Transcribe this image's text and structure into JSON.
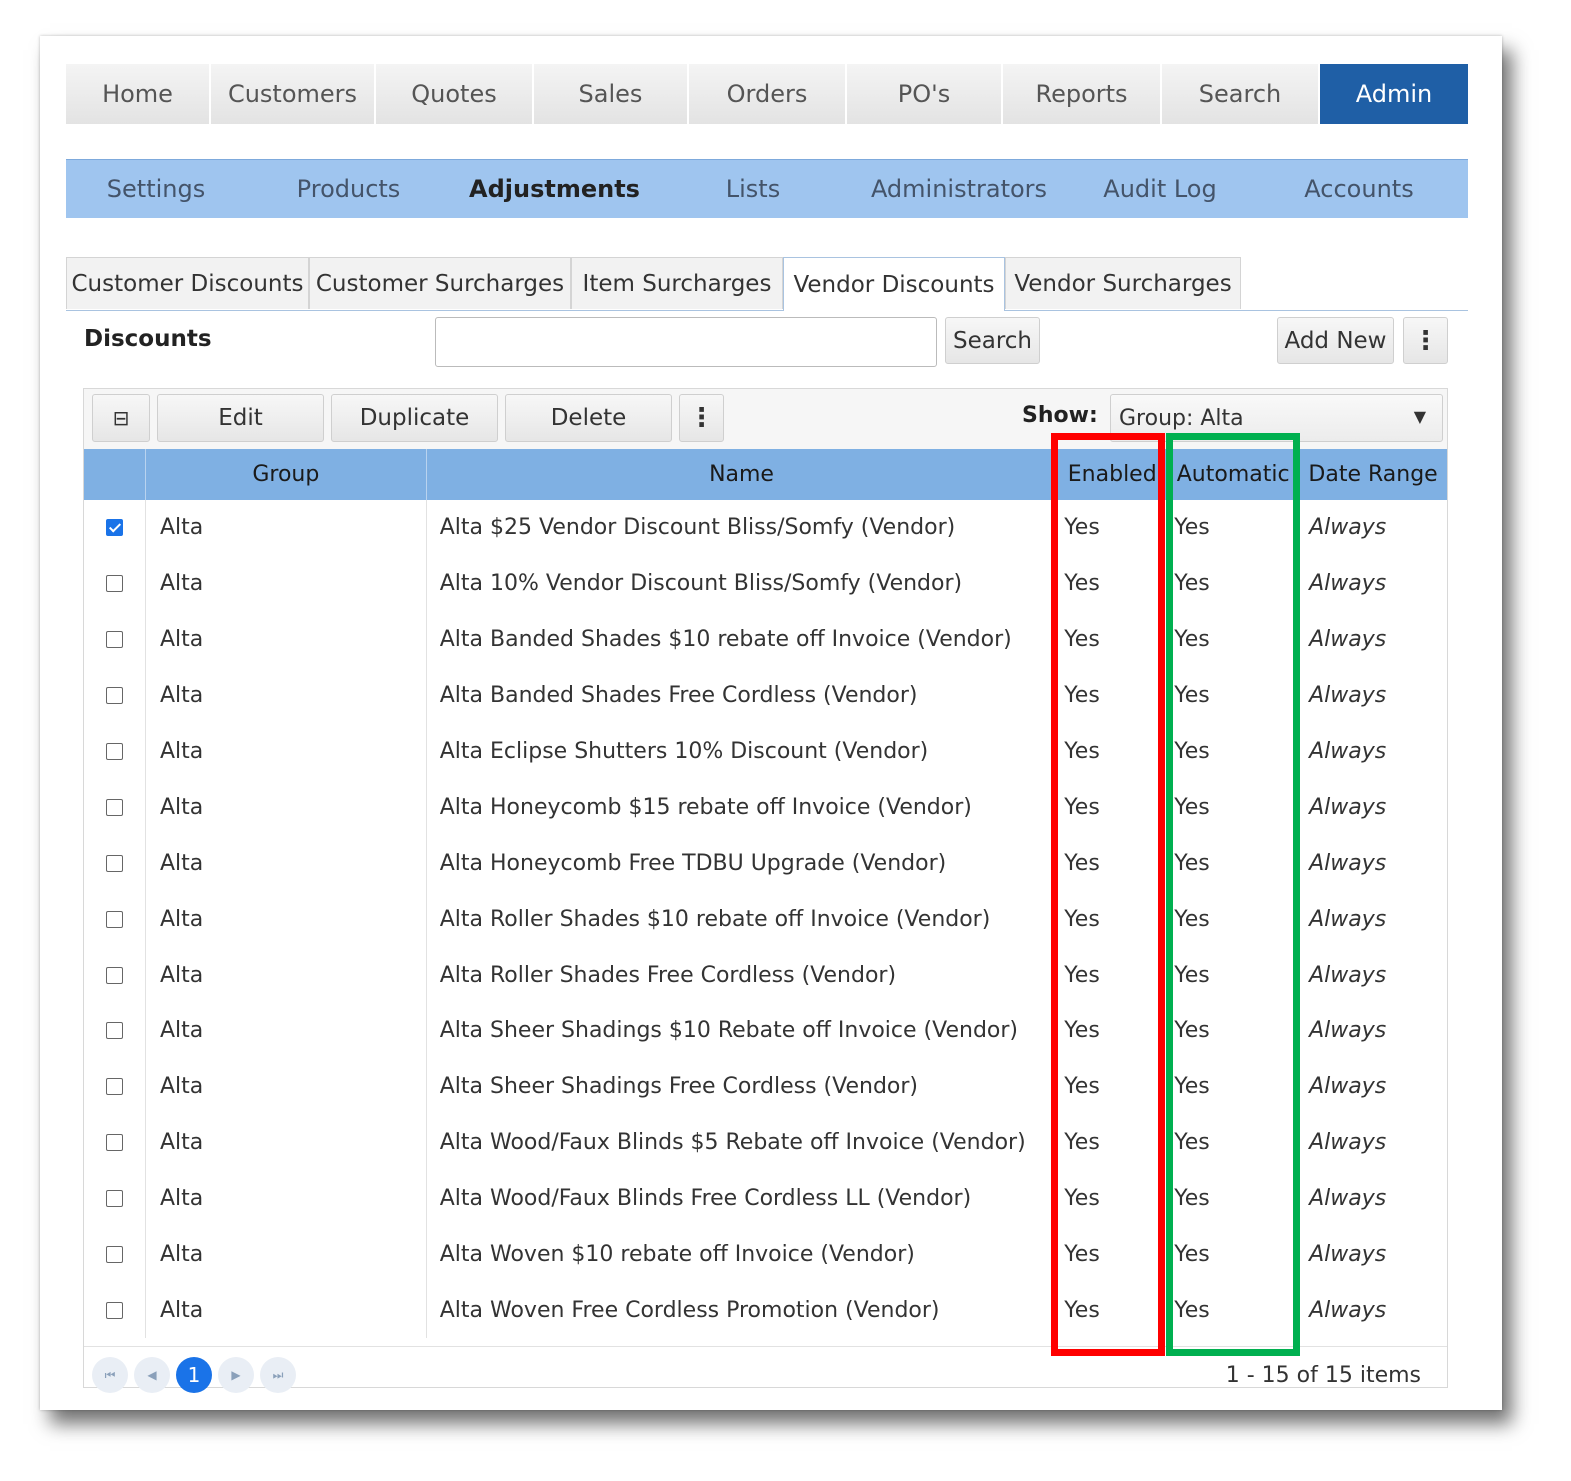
{
  "main_nav": [
    "Home",
    "Customers",
    "Quotes",
    "Sales",
    "Orders",
    "PO's",
    "Reports",
    "Search",
    "Admin"
  ],
  "main_nav_active": "Admin",
  "sub_nav": [
    "Settings",
    "Products",
    "Adjustments",
    "Lists",
    "Administrators",
    "Audit Log",
    "Accounts"
  ],
  "sub_nav_active": "Adjustments",
  "tabs": [
    "Customer Discounts",
    "Customer Surcharges",
    "Item Surcharges",
    "Vendor Discounts",
    "Vendor Surcharges"
  ],
  "tabs_active": "Vendor Discounts",
  "section": {
    "title": "Discounts",
    "search_value": "",
    "search_button": "Search",
    "add_new_button": "Add New",
    "more_icon": "vertical-ellipsis-icon"
  },
  "toolbar": {
    "edit": "Edit",
    "duplicate": "Duplicate",
    "delete": "Delete",
    "show_label": "Show:",
    "show_value": "Group: Alta"
  },
  "table": {
    "columns": [
      "Group",
      "Name",
      "Enabled",
      "Automatic",
      "Date Range"
    ],
    "rows": [
      {
        "checked": true,
        "group": "Alta",
        "name": "Alta $25 Vendor Discount Bliss/Somfy (Vendor)",
        "enabled": "Yes",
        "automatic": "Yes",
        "date_range": "Always"
      },
      {
        "checked": false,
        "group": "Alta",
        "name": "Alta 10% Vendor Discount Bliss/Somfy (Vendor)",
        "enabled": "Yes",
        "automatic": "Yes",
        "date_range": "Always"
      },
      {
        "checked": false,
        "group": "Alta",
        "name": "Alta Banded Shades $10 rebate off Invoice (Vendor)",
        "enabled": "Yes",
        "automatic": "Yes",
        "date_range": "Always"
      },
      {
        "checked": false,
        "group": "Alta",
        "name": "Alta Banded Shades Free Cordless (Vendor)",
        "enabled": "Yes",
        "automatic": "Yes",
        "date_range": "Always"
      },
      {
        "checked": false,
        "group": "Alta",
        "name": "Alta Eclipse Shutters 10% Discount (Vendor)",
        "enabled": "Yes",
        "automatic": "Yes",
        "date_range": "Always"
      },
      {
        "checked": false,
        "group": "Alta",
        "name": "Alta Honeycomb $15 rebate off Invoice (Vendor)",
        "enabled": "Yes",
        "automatic": "Yes",
        "date_range": "Always"
      },
      {
        "checked": false,
        "group": "Alta",
        "name": "Alta Honeycomb Free TDBU Upgrade (Vendor)",
        "enabled": "Yes",
        "automatic": "Yes",
        "date_range": "Always"
      },
      {
        "checked": false,
        "group": "Alta",
        "name": "Alta Roller Shades $10 rebate off Invoice (Vendor)",
        "enabled": "Yes",
        "automatic": "Yes",
        "date_range": "Always"
      },
      {
        "checked": false,
        "group": "Alta",
        "name": "Alta Roller Shades Free Cordless (Vendor)",
        "enabled": "Yes",
        "automatic": "Yes",
        "date_range": "Always"
      },
      {
        "checked": false,
        "group": "Alta",
        "name": "Alta Sheer Shadings $10 Rebate off Invoice (Vendor)",
        "enabled": "Yes",
        "automatic": "Yes",
        "date_range": "Always"
      },
      {
        "checked": false,
        "group": "Alta",
        "name": "Alta Sheer Shadings Free Cordless (Vendor)",
        "enabled": "Yes",
        "automatic": "Yes",
        "date_range": "Always"
      },
      {
        "checked": false,
        "group": "Alta",
        "name": "Alta Wood/Faux Blinds $5 Rebate off Invoice (Vendor)",
        "enabled": "Yes",
        "automatic": "Yes",
        "date_range": "Always"
      },
      {
        "checked": false,
        "group": "Alta",
        "name": "Alta Wood/Faux Blinds Free Cordless LL (Vendor)",
        "enabled": "Yes",
        "automatic": "Yes",
        "date_range": "Always"
      },
      {
        "checked": false,
        "group": "Alta",
        "name": "Alta Woven $10 rebate off Invoice (Vendor)",
        "enabled": "Yes",
        "automatic": "Yes",
        "date_range": "Always"
      },
      {
        "checked": false,
        "group": "Alta",
        "name": "Alta Woven Free Cordless Promotion (Vendor)",
        "enabled": "Yes",
        "automatic": "Yes",
        "date_range": "Always"
      }
    ]
  },
  "pager": {
    "current_page": "1",
    "info": "1 - 15 of 15 items"
  },
  "highlights": {
    "enabled_column_color": "#ff0000",
    "automatic_column_color": "#00b050"
  },
  "colors": {
    "admin_active": "#1f5fa6",
    "subnav_bg": "#9fc5ef",
    "table_header": "#7fb0e3",
    "checkbox_checked": "#1a73e8"
  }
}
